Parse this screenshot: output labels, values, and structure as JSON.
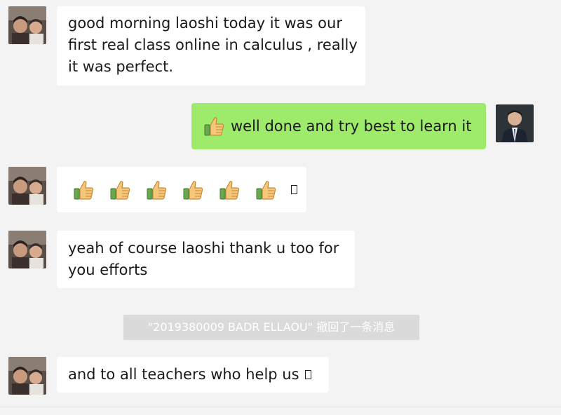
{
  "messages": [
    {
      "sender": "other",
      "lines": [
        "good morning laoshi today it was our",
        "first real class online in calculus , really",
        "it was perfect."
      ]
    },
    {
      "sender": "me",
      "text": "well done and try best to learn it"
    },
    {
      "sender": "other",
      "emoji": "thumbs-up",
      "count": 6
    },
    {
      "sender": "other",
      "lines": [
        "yeah of course laoshi thank u too for",
        "you efforts"
      ]
    },
    {
      "sender": "other",
      "text": "and to all teachers who help us"
    }
  ],
  "recall_notice": "\"2019380009 BADR ELLAOU\" 撤回了一条消息",
  "colors": {
    "background": "#f3f3f3",
    "bubble_other": "#ffffff",
    "bubble_me": "#9eea6a",
    "recall_bg": "#dadada"
  },
  "icons": {
    "other_avatar": "two-people-selfie-avatar",
    "my_avatar": "man-in-suit-avatar",
    "emoji": "thumbs-up-icon",
    "missing_glyph": "box-glyph"
  }
}
